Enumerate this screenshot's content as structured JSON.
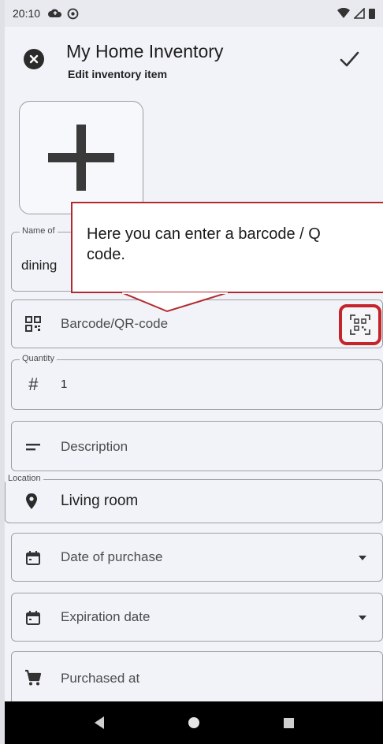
{
  "status_bar": {
    "time": "20:10",
    "left_icons": [
      "cloud-icon",
      "sync-icon"
    ],
    "right_icons": [
      "wifi-icon",
      "signal-icon",
      "battery-icon"
    ]
  },
  "app_bar": {
    "title": "My Home Inventory",
    "subtitle": "Edit inventory item",
    "close_icon": "close-icon",
    "save_icon": "check-icon"
  },
  "photo": {
    "icon": "plus-icon"
  },
  "fields": {
    "name": {
      "legend": "Name of",
      "value": "dining"
    },
    "barcode": {
      "placeholder": "Barcode/QR-code",
      "icon": "qr-code-icon",
      "scan_icon": "qr-scan-icon"
    },
    "quantity": {
      "legend": "Quantity",
      "value": "1",
      "icon": "hash-icon"
    },
    "description": {
      "placeholder": "Description",
      "icon": "notes-icon"
    },
    "location": {
      "legend": "Location",
      "value": "Living room",
      "icon": "location-pin-icon"
    },
    "date_of_purchase": {
      "placeholder": "Date of purchase",
      "icon": "calendar-icon"
    },
    "expiration_date": {
      "placeholder": "Expiration date",
      "icon": "calendar-icon"
    },
    "purchased_at": {
      "placeholder": "Purchased at",
      "icon": "shopping-cart-icon"
    }
  },
  "tooltip": {
    "line1": "Here you can enter a barcode / Q",
    "line2": "code."
  },
  "nav_bar": {
    "icons": [
      "back-icon",
      "home-icon",
      "recents-icon"
    ]
  },
  "colors": {
    "highlight": "#c4252b",
    "background": "#f2f3f8",
    "nav": "#000000"
  }
}
